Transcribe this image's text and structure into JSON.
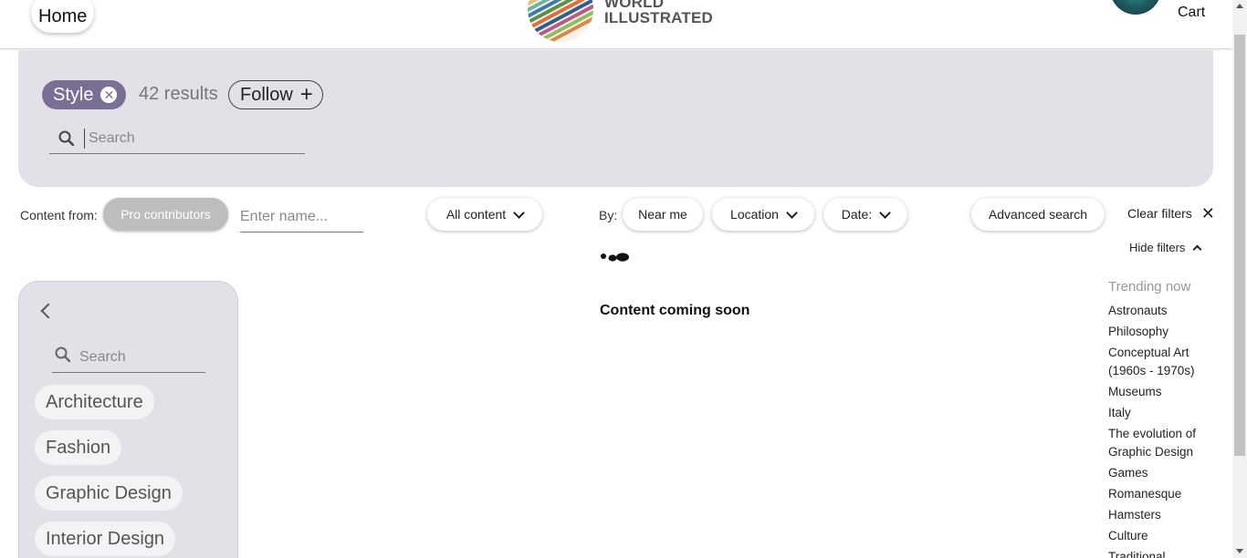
{
  "header": {
    "home_label": "Home",
    "brand_line1": "WORLD",
    "brand_line2": "ILLUSTRATED",
    "cart_label": "Cart"
  },
  "filter_panel": {
    "chip_label": "Style",
    "results_count": "42 results",
    "follow_label": "Follow",
    "search_placeholder": "Search"
  },
  "filter_row": {
    "content_from_label": "Content from:",
    "pro_contributors_label": "Pro contributors",
    "name_placeholder": "Enter name...",
    "all_content_label": "All content",
    "by_label": "By:",
    "near_me_label": "Near me",
    "location_label": "Location",
    "date_label": "Date:",
    "advanced_search_label": "Advanced search",
    "clear_filters_label": "Clear filters",
    "hide_filters_label": "Hide filters"
  },
  "main": {
    "empty_message": "Content coming soon"
  },
  "categories": {
    "search_placeholder": "Search",
    "items": [
      "Architecture",
      "Fashion",
      "Graphic Design",
      "Interior Design"
    ]
  },
  "trending": {
    "title": "Trending now",
    "items": [
      "Astronauts",
      "Philosophy",
      "Conceptual Art (1960s - 1970s)",
      "Museums",
      "Italy",
      "The evolution of Graphic Design",
      "Games",
      "Romanesque",
      "Hamsters",
      "Culture",
      "Traditional"
    ]
  },
  "colors": {
    "panel_bg": "#e3e0e8",
    "chip_accent": "#7b6f96",
    "pro_pill": "#bdbdbd"
  }
}
